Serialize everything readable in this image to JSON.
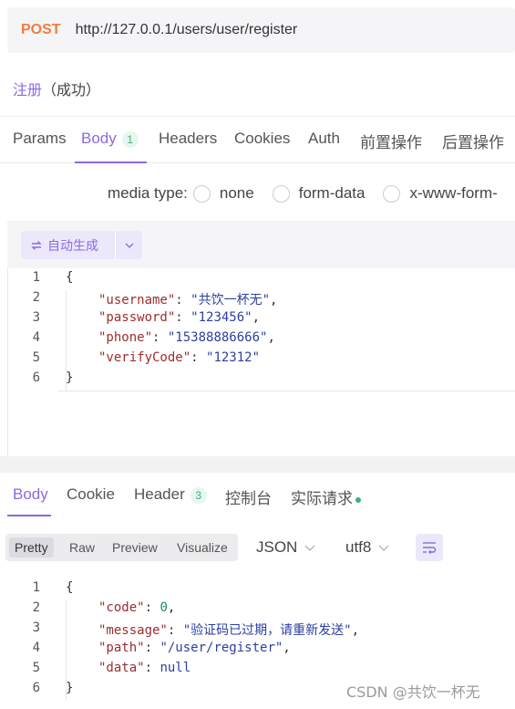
{
  "request": {
    "method": "POST",
    "url": "http://127.0.0.1/users/user/register"
  },
  "api": {
    "name": "注册",
    "status": "（成功）"
  },
  "request_tabs": [
    {
      "label": "Params"
    },
    {
      "label": "Body",
      "count": "1"
    },
    {
      "label": "Headers"
    },
    {
      "label": "Cookies"
    },
    {
      "label": "Auth"
    },
    {
      "label": "前置操作"
    },
    {
      "label": "后置操作"
    }
  ],
  "media": {
    "label": "media type:",
    "options": [
      "none",
      "form-data",
      "x-www-form-"
    ]
  },
  "generate": {
    "label": "自动生成"
  },
  "request_body": {
    "line_numbers": [
      "1",
      "2",
      "3",
      "4",
      "5",
      "6"
    ],
    "open_brace": "{",
    "close_brace": "}",
    "fields": [
      {
        "key": "\"username\"",
        "value": "\"共饮一杯无\"",
        "comma": ","
      },
      {
        "key": "\"password\"",
        "value": "\"123456\"",
        "comma": ","
      },
      {
        "key": "\"phone\"",
        "value": "\"15388886666\"",
        "comma": ","
      },
      {
        "key": "\"verifyCode\"",
        "value": "\"12312\"",
        "comma": ""
      }
    ]
  },
  "response_tabs": [
    {
      "label": "Body"
    },
    {
      "label": "Cookie"
    },
    {
      "label": "Header",
      "count": "3"
    },
    {
      "label": "控制台"
    },
    {
      "label": "实际请求"
    }
  ],
  "view": {
    "modes": [
      "Pretty",
      "Raw",
      "Preview",
      "Visualize"
    ],
    "format": "JSON",
    "encoding": "utf8"
  },
  "response_body": {
    "line_numbers": [
      "1",
      "2",
      "3",
      "4",
      "5",
      "6"
    ],
    "open_brace": "{",
    "close_brace": "}",
    "fields": [
      {
        "key": "\"code\"",
        "value": "0",
        "comma": ",",
        "type": "number"
      },
      {
        "key": "\"message\"",
        "value": "\"验证码已过期，请重新发送\"",
        "comma": ",",
        "type": "string"
      },
      {
        "key": "\"path\"",
        "value": "\"/user/register\"",
        "comma": ",",
        "type": "string"
      },
      {
        "key": "\"data\"",
        "value": "null",
        "comma": "",
        "type": "literal"
      }
    ]
  },
  "watermark": "CSDN @共饮一杯无",
  "colors": {
    "accent": "#8a6ae0",
    "method": "#f27c3e",
    "badge_green": "#3db07a",
    "json_key": "#9b2d2d",
    "json_string": "#2d3fa0"
  },
  "icons": [
    "refresh-icon",
    "chevron-down-icon",
    "wrap-lines-icon",
    "radio-icon",
    "status-dot-icon"
  ]
}
